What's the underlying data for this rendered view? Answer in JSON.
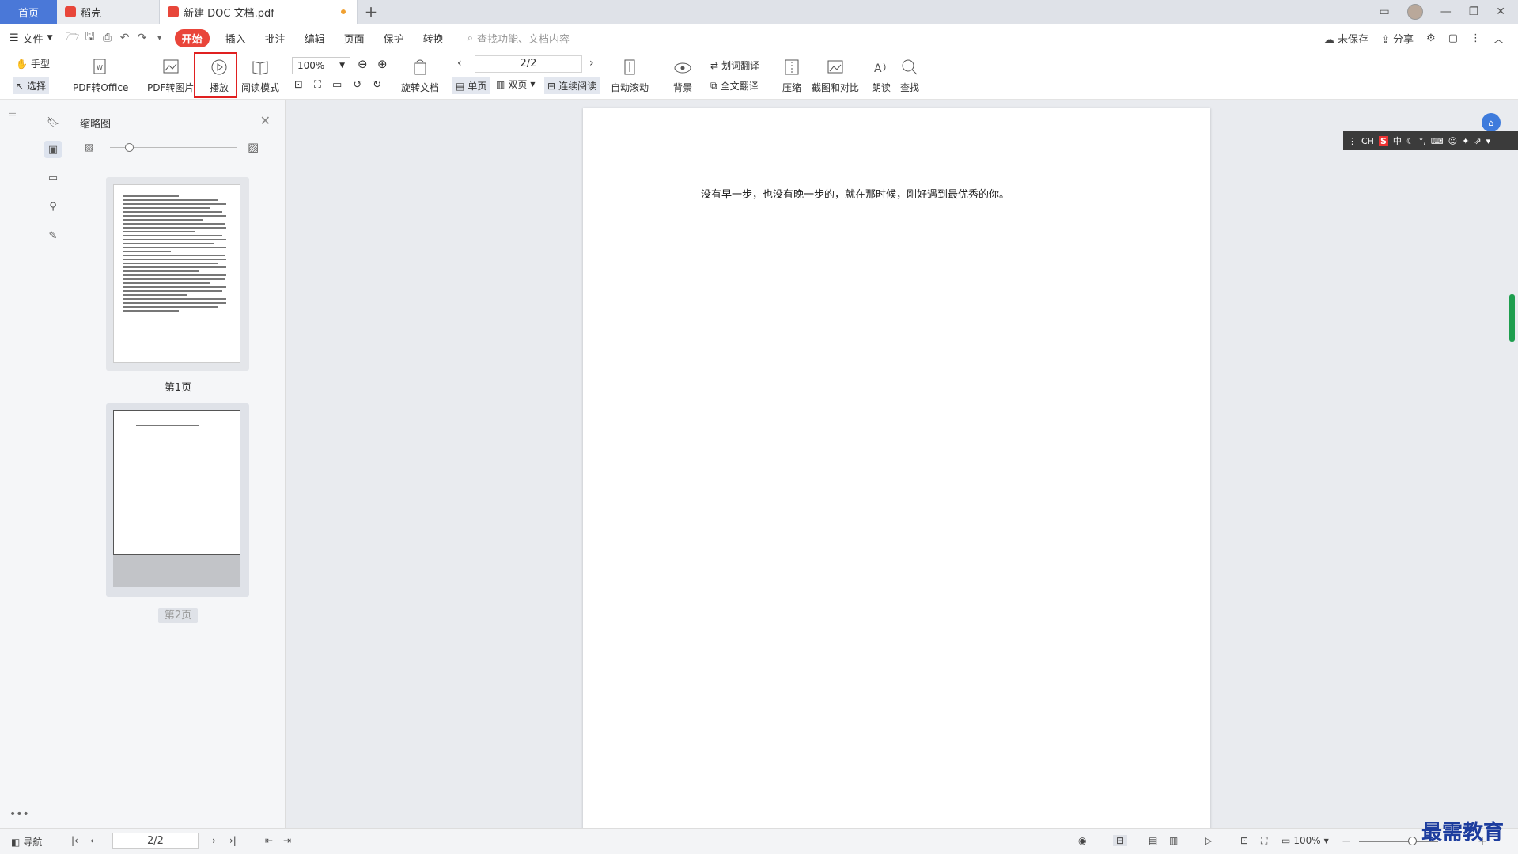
{
  "tabs": {
    "home": "首页",
    "docer": "稻壳",
    "active": "新建 DOC 文档.pdf",
    "add": "+"
  },
  "menu": {
    "file": "文件",
    "tabs": [
      "开始",
      "插入",
      "批注",
      "编辑",
      "页面",
      "保护",
      "转换"
    ],
    "search_placeholder": "查找功能、文档内容",
    "unsaved": "未保存",
    "share": "分享"
  },
  "toolbar": {
    "hand": "手型",
    "select": "选择",
    "pdf_to_office": "PDF转Office",
    "pdf_to_image": "PDF转图片",
    "play": "播放",
    "read_mode": "阅读模式",
    "zoom": "100%",
    "rotate_doc": "旋转文档",
    "page_value": "2/2",
    "single_page": "单页",
    "double_page": "双页",
    "continuous_read": "连续阅读",
    "auto_scroll": "自动滚动",
    "background": "背景",
    "word_translate": "划词翻译",
    "full_translate": "全文翻译",
    "compress": "压缩",
    "screenshot_compare": "截图和对比",
    "read_aloud": "朗读",
    "find": "查找"
  },
  "thumbnails": {
    "title": "缩略图",
    "pages": [
      "第1页",
      "第2页"
    ]
  },
  "document": {
    "text": "没有早一步，也没有晚一步的，就在那时候，刚好遇到最优秀的你。"
  },
  "ime": {
    "lang": "CH",
    "logo": "S",
    "mode": "中"
  },
  "statusbar": {
    "nav": "导航",
    "page_value": "2/2",
    "zoom": "100%"
  },
  "watermark": "最需教育",
  "colors": {
    "accent": "#e9453a",
    "home_tab": "#4a78d8",
    "highlight": "#e02020"
  }
}
